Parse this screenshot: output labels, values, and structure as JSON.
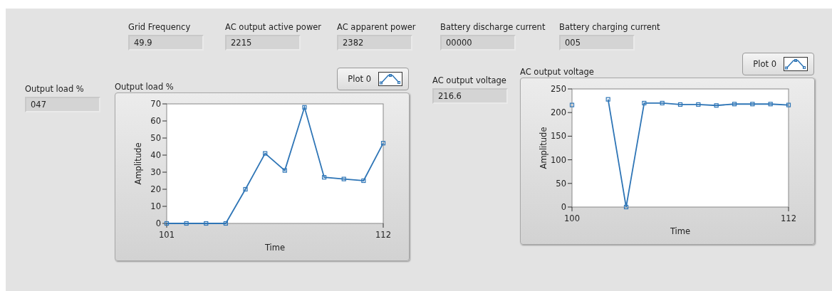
{
  "indicators": [
    {
      "label": "Grid Frequency",
      "value": "49.9"
    },
    {
      "label": "AC output active power",
      "value": "2215"
    },
    {
      "label": "AC apparent power",
      "value": "2382"
    },
    {
      "label": "Battery discharge current",
      "value": "00000"
    },
    {
      "label": "Battery charging current",
      "value": "005"
    }
  ],
  "panels": [
    {
      "indicator": {
        "label": "Output load %",
        "value": "047"
      },
      "graph": {
        "title": "Output load %",
        "chart_data": {
          "type": "line",
          "xlabel": "Time",
          "ylabel": "Amplitude",
          "x": [
            101,
            102,
            103,
            104,
            105,
            106,
            107,
            108,
            109,
            110,
            111,
            112
          ],
          "series": [
            {
              "name": "Plot 0",
              "color": "#2e75b6",
              "marker": "square",
              "values": [
                0,
                0,
                0,
                0,
                20,
                41,
                31,
                68,
                27,
                26,
                25,
                47
              ]
            }
          ],
          "xlim": [
            101,
            112
          ],
          "ylim": [
            0,
            70
          ],
          "xticks": [
            101,
            112
          ],
          "yticks": [
            0,
            10,
            20,
            30,
            40,
            50,
            60,
            70
          ]
        }
      }
    },
    {
      "indicator": {
        "label": "AC output voltage",
        "value": "216.6"
      },
      "graph": {
        "title": "AC output voltage",
        "chart_data": {
          "type": "line",
          "xlabel": "Time",
          "ylabel": "Amplitude",
          "x": [
            100,
            101,
            102,
            103,
            104,
            105,
            106,
            107,
            108,
            109,
            110,
            111,
            112
          ],
          "series": [
            {
              "name": "Plot 0",
              "color": "#2e75b6",
              "marker": "square",
              "values": [
                216,
                null,
                228,
                0,
                220,
                220,
                217,
                217,
                215,
                218,
                218,
                218,
                216
              ]
            }
          ],
          "xlim": [
            100,
            112
          ],
          "ylim": [
            0,
            250
          ],
          "xticks": [
            100,
            112
          ],
          "yticks": [
            0,
            50,
            100,
            150,
            200,
            250
          ]
        }
      }
    }
  ]
}
